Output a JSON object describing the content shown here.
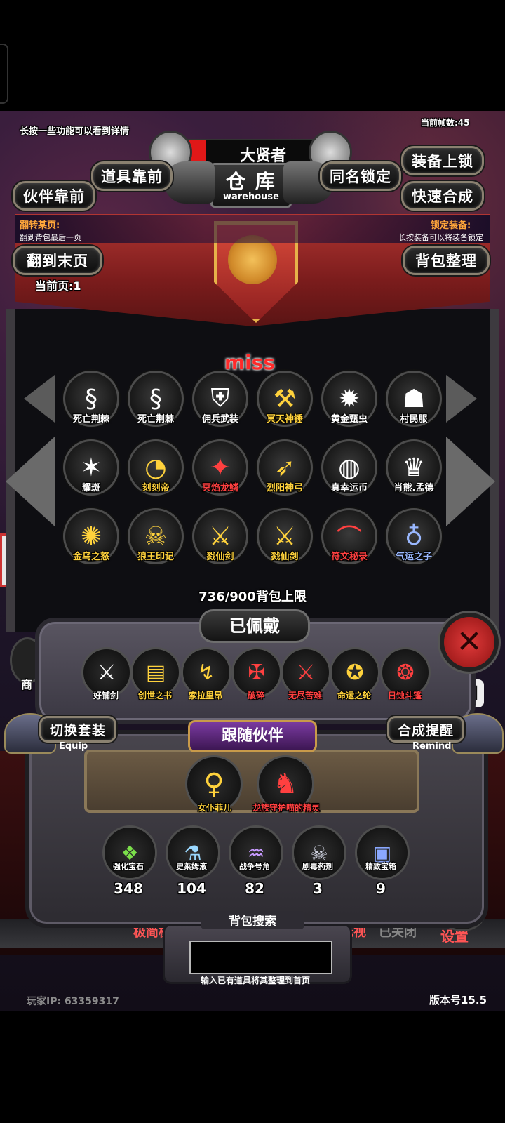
{
  "hud": {
    "hint": "长按一些功能可以看到详情",
    "fps": "当前帧数:45",
    "player_name": "大贤者",
    "title": "仓 库",
    "title_en": "warehouse"
  },
  "buttons": {
    "items_first": "道具靠前",
    "partner_first": "伙伴靠前",
    "same_name_lock": "同名锁定",
    "equip_lock": "装备上锁",
    "quick_merge": "快速合成",
    "last_page": "翻到末页",
    "bag_sort": "背包整理",
    "switch_set": "切换套装",
    "switch_set_en": "Equip",
    "merge_remind": "合成提醒",
    "merge_remind_en": "Remind"
  },
  "info": {
    "flip_title": "翻转某页:",
    "flip_desc": "翻到背包最后一页",
    "lock_title": "锁定装备:",
    "lock_desc": "长按装备可以将装备锁定",
    "current_page": "当前页:1"
  },
  "miss_text": "miss",
  "items": [
    {
      "name": "死亡荆棘",
      "icon": "§",
      "color": "#ffffff"
    },
    {
      "name": "死亡荆棘",
      "icon": "§",
      "color": "#ffffff"
    },
    {
      "name": "佣兵武装",
      "icon": "⛨",
      "color": "#ffffff"
    },
    {
      "name": "冥天神锤",
      "icon": "⚒",
      "color": "#ffd23c"
    },
    {
      "name": "黄金甄虫",
      "icon": "✹",
      "color": "#ffffff"
    },
    {
      "name": "村民服",
      "icon": "☗",
      "color": "#ffffff"
    },
    {
      "name": "耀斑",
      "icon": "✶",
      "color": "#ffffff"
    },
    {
      "name": "刻刻帝",
      "icon": "◔",
      "color": "#ffd23c"
    },
    {
      "name": "冥焰龙鳞",
      "icon": "✦",
      "color": "#ff4040"
    },
    {
      "name": "烈阳神弓",
      "icon": "➶",
      "color": "#ffd23c"
    },
    {
      "name": "真幸运币",
      "icon": "◍",
      "color": "#ffffff"
    },
    {
      "name": "肖熊.孟德",
      "icon": "♛",
      "color": "#ffffff"
    },
    {
      "name": "金乌之怒",
      "icon": "✺",
      "color": "#ffd23c"
    },
    {
      "name": "狼王印记",
      "icon": "☠",
      "color": "#ffd23c"
    },
    {
      "name": "戮仙剑",
      "icon": "⚔",
      "color": "#ffd23c"
    },
    {
      "name": "戮仙剑",
      "icon": "⚔",
      "color": "#ffd23c"
    },
    {
      "name": "符文秘录",
      "icon": "⌒",
      "color": "#ff4040"
    },
    {
      "name": "气运之子",
      "icon": "♁",
      "color": "#9ab8ff"
    }
  ],
  "capacity": "736/900背包上限",
  "equipped": {
    "title": "已佩戴",
    "items": [
      {
        "name": "好铺剑",
        "icon": "⚔",
        "color": "#ffffff"
      },
      {
        "name": "创世之书",
        "icon": "▤",
        "color": "#ffd23c"
      },
      {
        "name": "索拉里昂",
        "icon": "↯",
        "color": "#ffd23c"
      },
      {
        "name": "破碎",
        "icon": "✠",
        "color": "#ff4040"
      },
      {
        "name": "无尽苦难",
        "icon": "⚔",
        "color": "#ff4040"
      },
      {
        "name": "命运之轮",
        "icon": "✪",
        "color": "#ffd23c"
      },
      {
        "name": "日蚀斗篷",
        "icon": "❂",
        "color": "#ff4040"
      }
    ]
  },
  "companion": {
    "title": "跟随伙伴",
    "members": [
      {
        "name": "女仆菲儿",
        "icon": "♀",
        "color": "#ffd23c"
      },
      {
        "name": "龙族守护喵的精灵",
        "icon": "♞",
        "color": "#ff4040"
      }
    ]
  },
  "resources": [
    {
      "name": "强化宝石",
      "count": "348",
      "icon": "❖"
    },
    {
      "name": "史莱姆液",
      "count": "104",
      "icon": "⚗"
    },
    {
      "name": "战争号角",
      "count": "82",
      "icon": "♒"
    },
    {
      "name": "剧毒药剂",
      "count": "3",
      "icon": "☠"
    },
    {
      "name": "精致宝箱",
      "count": "9",
      "icon": "▣"
    }
  ],
  "search": {
    "title": "背包搜索",
    "hint": "输入已有道具将其整理到首页",
    "value": ""
  },
  "background_menu": {
    "left": "极简模",
    "mid": "无视",
    "closed": "已关闭",
    "settings": "设置",
    "shop": "商"
  },
  "footer": {
    "player_ip": "玩家IP:  63359317",
    "version": "版本号15.5"
  },
  "colors": {
    "banner_red": "#b23532",
    "gold": "#e6b24a",
    "close_red": "#c0262a",
    "rare_yellow": "#ffd23c",
    "epic_red": "#ff4040",
    "miss_red": "#ff2a2a"
  }
}
